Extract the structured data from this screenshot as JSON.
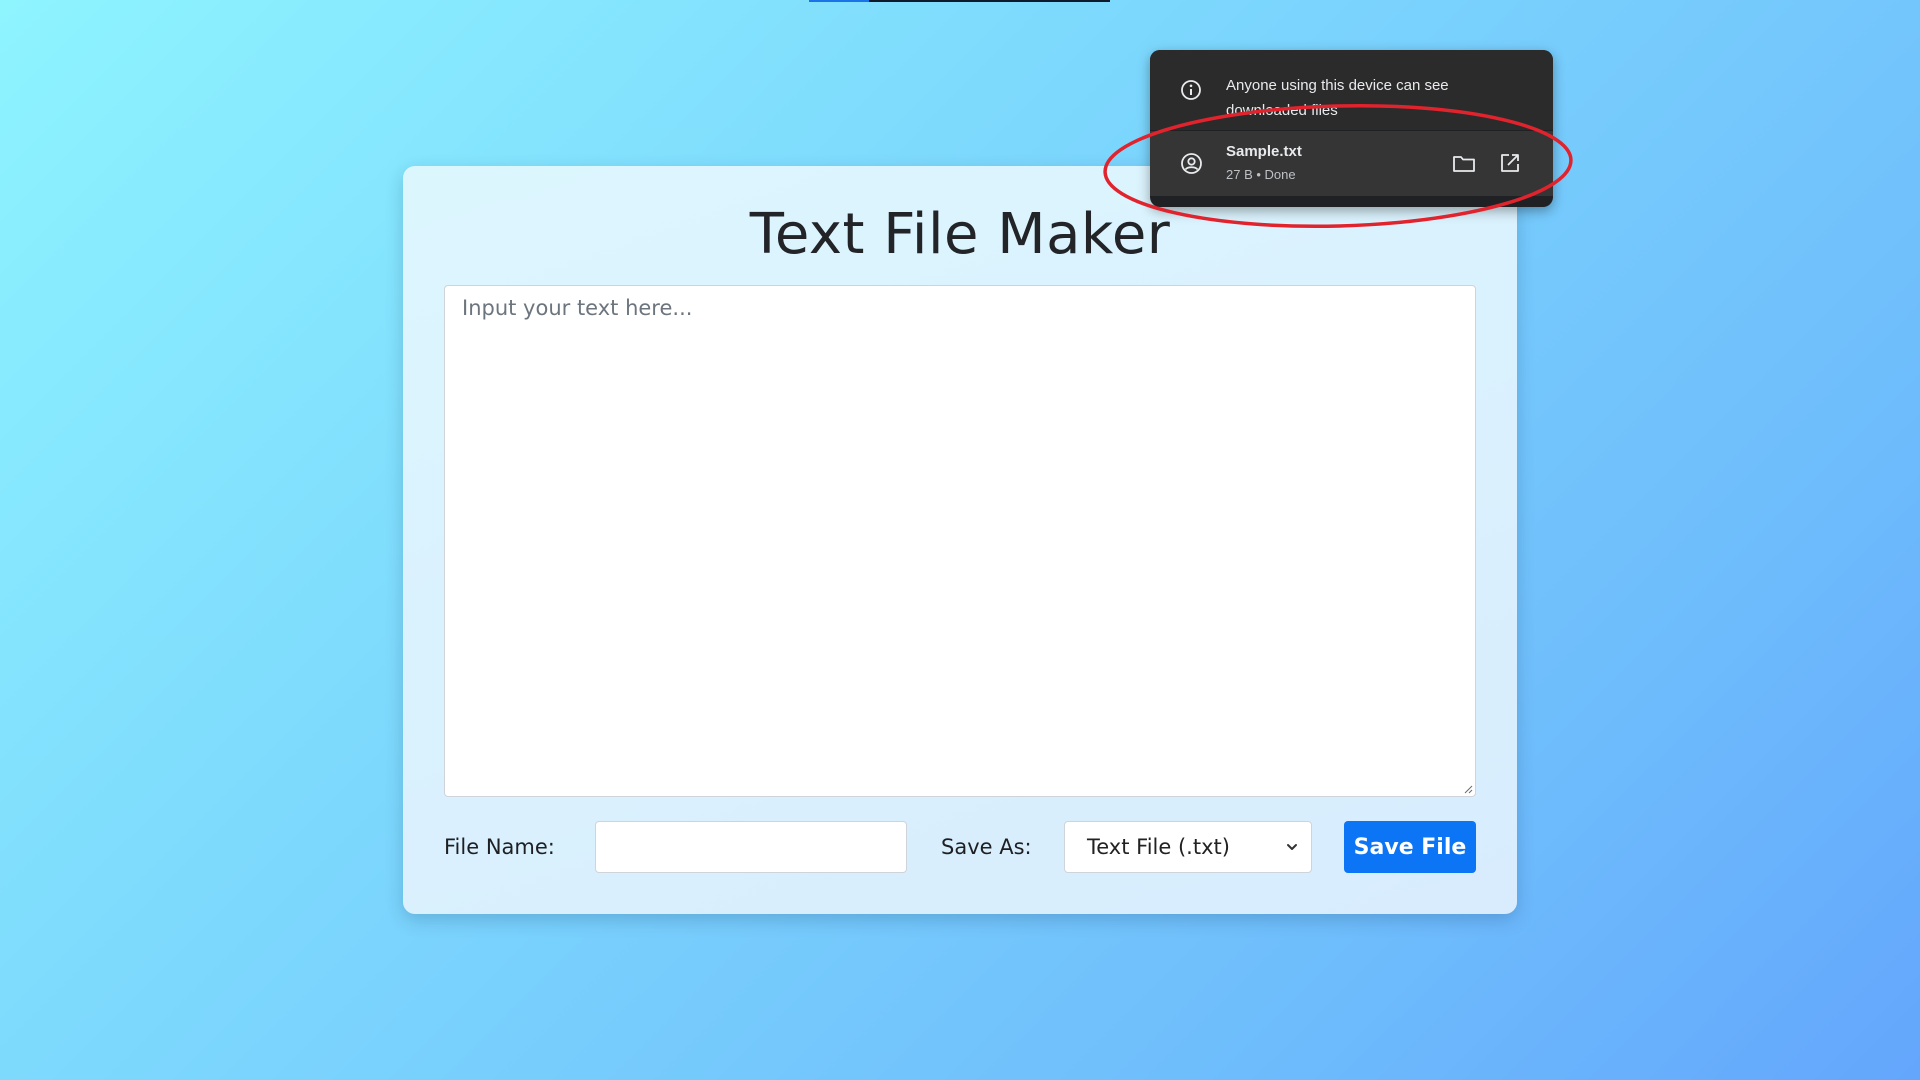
{
  "app": {
    "title": "Text File Maker"
  },
  "editor": {
    "placeholder": "Input your text here...",
    "value": ""
  },
  "controls": {
    "file_name_label": "File Name:",
    "file_name_value": "",
    "save_as_label": "Save As:",
    "save_as_selected": "Text File (.txt)",
    "save_button_label": "Save File"
  },
  "download_popup": {
    "info_text": "Anyone using this device can see downloaded files",
    "info_icon": "info-icon",
    "item": {
      "icon": "account-circle-icon",
      "file_name": "Sample.txt",
      "status": "27 B • Done",
      "folder_icon": "folder-icon",
      "open_icon": "open-external-icon"
    }
  },
  "colors": {
    "primary_button": "#0b75f6",
    "annotation": "#e0232d",
    "popup_bg": "#202124"
  }
}
